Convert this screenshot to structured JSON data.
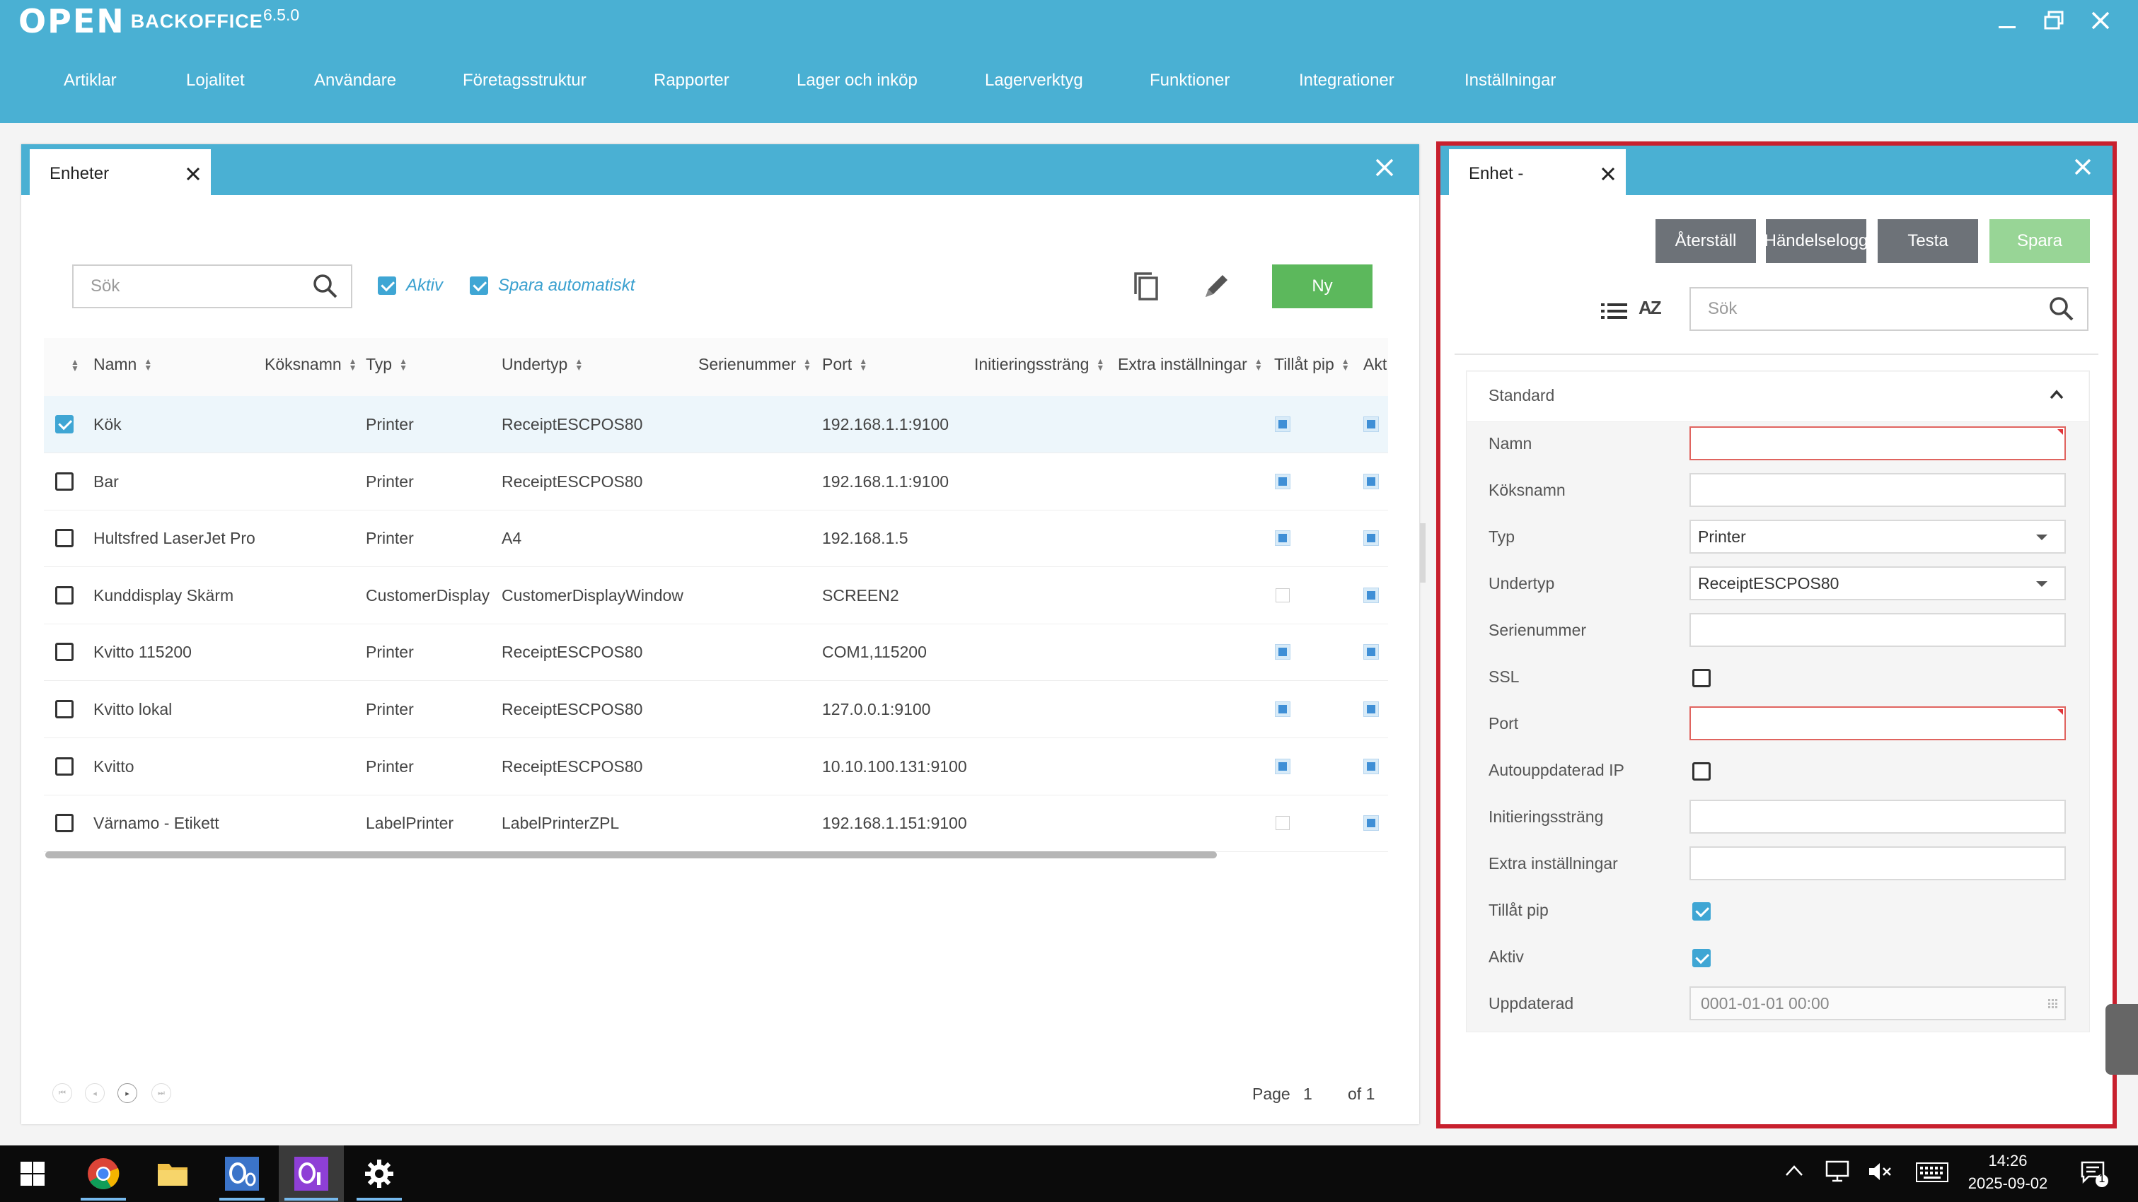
{
  "app": {
    "logo_mark": "ΟΡΕΝ",
    "logo_name": "BACKOFFICE",
    "version": "6.5.0"
  },
  "menu": [
    "Artiklar",
    "Lojalitet",
    "Användare",
    "Företagsstruktur",
    "Rapporter",
    "Lager och inköp",
    "Lagerverktyg",
    "Funktioner",
    "Integrationer",
    "Inställningar"
  ],
  "left": {
    "tab_title": "Enheter",
    "search_placeholder": "Sök",
    "chk_aktiv": "Aktiv",
    "chk_spara": "Spara automatiskt",
    "new_button": "Ny",
    "columns": [
      "Namn",
      "Köksnamn",
      "Typ",
      "Undertyp",
      "Serienummer",
      "Port",
      "Initieringssträng",
      "Extra inställningar",
      "Tillåt pip",
      "Akt"
    ],
    "rows": [
      {
        "checked": true,
        "name": "Kök",
        "kitchen": "",
        "type": "Printer",
        "subtype": "ReceiptESCPOS80",
        "serial": "",
        "port": "192.168.1.1:9100",
        "pip": true,
        "active": true
      },
      {
        "checked": false,
        "name": "Bar",
        "kitchen": "",
        "type": "Printer",
        "subtype": "ReceiptESCPOS80",
        "serial": "",
        "port": "192.168.1.1:9100",
        "pip": true,
        "active": true
      },
      {
        "checked": false,
        "name": "Hultsfred LaserJet Pro",
        "kitchen": "",
        "type": "Printer",
        "subtype": "A4",
        "serial": "",
        "port": "192.168.1.5",
        "pip": true,
        "active": true
      },
      {
        "checked": false,
        "name": "Kunddisplay Skärm",
        "kitchen": "",
        "type": "CustomerDisplay",
        "subtype": "CustomerDisplayWindow",
        "serial": "",
        "port": "SCREEN2",
        "pip": false,
        "active": true
      },
      {
        "checked": false,
        "name": "Kvitto 115200",
        "kitchen": "",
        "type": "Printer",
        "subtype": "ReceiptESCPOS80",
        "serial": "",
        "port": "COM1,115200",
        "pip": true,
        "active": true
      },
      {
        "checked": false,
        "name": "Kvitto lokal",
        "kitchen": "",
        "type": "Printer",
        "subtype": "ReceiptESCPOS80",
        "serial": "",
        "port": "127.0.0.1:9100",
        "pip": true,
        "active": true
      },
      {
        "checked": false,
        "name": "Kvitto",
        "kitchen": "",
        "type": "Printer",
        "subtype": "ReceiptESCPOS80",
        "serial": "",
        "port": "10.10.100.131:9100",
        "pip": true,
        "active": true
      },
      {
        "checked": false,
        "name": "Värnamo - Etikett",
        "kitchen": "",
        "type": "LabelPrinter",
        "subtype": "LabelPrinterZPL",
        "serial": "",
        "port": "192.168.1.151:9100",
        "pip": false,
        "active": true
      }
    ],
    "paging": {
      "page_label": "Page",
      "page": "1",
      "of_label": "of 1"
    }
  },
  "right": {
    "tab_title": "Enhet -",
    "buttons": {
      "reset": "Återställ",
      "log": "Händelselogg",
      "test": "Testa",
      "save": "Spara"
    },
    "search_placeholder": "Sök",
    "sort_label": "AZ",
    "section": "Standard",
    "fields": {
      "namn": {
        "label": "Namn",
        "value": ""
      },
      "koksnamn": {
        "label": "Köksnamn",
        "value": ""
      },
      "typ": {
        "label": "Typ",
        "value": "Printer"
      },
      "undertyp": {
        "label": "Undertyp",
        "value": "ReceiptESCPOS80"
      },
      "serienummer": {
        "label": "Serienummer",
        "value": ""
      },
      "ssl": {
        "label": "SSL",
        "checked": false
      },
      "port": {
        "label": "Port",
        "value": ""
      },
      "autoip": {
        "label": "Autouppdaterad IP",
        "checked": false
      },
      "init": {
        "label": "Initieringssträng",
        "value": ""
      },
      "extra": {
        "label": "Extra inställningar",
        "value": ""
      },
      "pip": {
        "label": "Tillåt pip",
        "checked": true
      },
      "aktiv": {
        "label": "Aktiv",
        "checked": true
      },
      "uppdaterad": {
        "label": "Uppdaterad",
        "value": "0001-01-01 00:00"
      }
    }
  },
  "taskbar": {
    "time": "14:26",
    "date": "2025-09-02",
    "notifications": "1",
    "accent": "#76b9ed"
  },
  "colors": {
    "brand": "#4ab0d3",
    "new_button": "#5cb85c",
    "selection_frame": "#c8202e"
  }
}
